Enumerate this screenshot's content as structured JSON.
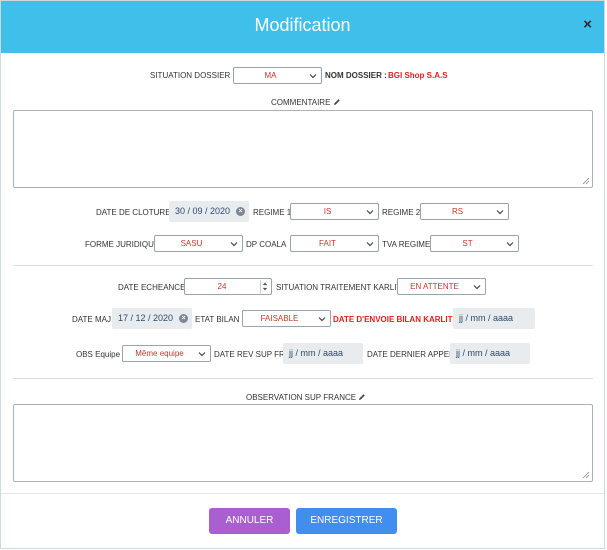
{
  "modal": {
    "title": "Modification",
    "close_label": "×"
  },
  "situation_dossier": {
    "label": "SITUATION DOSSIER :",
    "value": "MA"
  },
  "nom_dossier": {
    "label": "NOM DOSSIER :",
    "value": "BGI Shop S.A.S"
  },
  "commentaire": {
    "label": "COMMENTAIRE",
    "value": ""
  },
  "date_cloture": {
    "label": "DATE DE CLOTURE",
    "value": "30 / 09 / 2020"
  },
  "regime1": {
    "label": "REGIME 1",
    "value": "IS"
  },
  "regime2": {
    "label": "REGIME 2",
    "value": "RS"
  },
  "forme_juridique": {
    "label": "FORME JURIDIQUE",
    "value": "SASU"
  },
  "dp_coala": {
    "label": "DP COALA",
    "value": "FAIT"
  },
  "tva_regime": {
    "label": "TVA REGIME",
    "value": "ST"
  },
  "date_echeance": {
    "label": "DATE ECHEANCE",
    "value": "24"
  },
  "situation_traitement": {
    "label": "SITUATION TRAITEMENT KARLIT",
    "value": "EN ATTENTE"
  },
  "date_maj": {
    "label": "DATE MAJ",
    "value": "17 / 12 / 2020"
  },
  "etat_bilan": {
    "label": "ETAT BILAN",
    "value": "FAISABLE"
  },
  "date_envoie_bilan": {
    "label": "DATE D'ENVOIE BILAN KARLIT",
    "placeholder": "jj / mm / aaaa"
  },
  "obs_equipe": {
    "label": "OBS Equipe",
    "value": "Même equipe"
  },
  "date_rev_sup_fr": {
    "label": "DATE REV SUP FR",
    "placeholder": "jj / mm / aaaa"
  },
  "date_dernier_appel": {
    "label": "DATE DERNIER APPEL",
    "placeholder": "jj / mm / aaaa"
  },
  "observation_sup_france": {
    "label": "OBSERVATION SUP FRANCE",
    "value": ""
  },
  "footer": {
    "cancel_label": "ANNULER",
    "save_label": "ENREGISTRER"
  },
  "icons": {
    "edit": "pencil-icon",
    "dropdown": "chevron-down-icon",
    "clear": "clear-x-icon",
    "spin": "spinner-arrows-icon",
    "resize": "resize-grip-icon"
  },
  "colors": {
    "header": "#3fc0ea",
    "value_red": "#c0392b",
    "alert_red": "#e02020",
    "cancel": "#a95fcf",
    "save": "#3f8ef0"
  }
}
